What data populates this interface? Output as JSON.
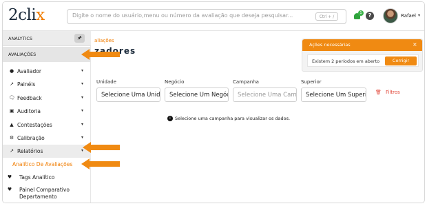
{
  "header": {
    "logo_main": "2cli",
    "logo_x": "x",
    "search_placeholder": "Digite o nome do usuário,menu ou número da avaliação que deseja pesquisar...",
    "search_shortcut": "Ctrl + /",
    "notification_count": "1",
    "help_label": "?",
    "user_name": "Rafael",
    "user_caret": "▾"
  },
  "sidebar": {
    "analytics_label": "ANALYTICS",
    "pin_icon": "🖈",
    "avaliacoes_label": "AVALIAÇÕES",
    "items": [
      {
        "icon": "●",
        "label": "Avaliador",
        "caret": "▾"
      },
      {
        "icon": "↗",
        "label": "Painéis",
        "caret": "▾"
      },
      {
        "icon": "🗨",
        "label": "Feedback",
        "caret": "▾"
      },
      {
        "icon": "▣",
        "label": "Auditoria",
        "caret": "▾"
      },
      {
        "icon": "▲",
        "label": "Contestações",
        "caret": "▾"
      },
      {
        "icon": "⚙",
        "label": "Calibração",
        "caret": "▾"
      },
      {
        "icon": "↗",
        "label": "Relatórios",
        "caret": "▾"
      }
    ],
    "sub_items": [
      {
        "icon": "",
        "label": "Analítico De Avaliações"
      },
      {
        "icon": "♥",
        "label": "Tags Analítico"
      },
      {
        "icon": "♥",
        "label": "Painel Comparativo"
      },
      {
        "icon": "",
        "label": "Departamento"
      }
    ]
  },
  "main": {
    "breadcrumb": "aliações",
    "title": "zadores",
    "filters": [
      {
        "label": "Unidade",
        "value": "Selecione Uma Unida"
      },
      {
        "label": "Negócio",
        "value": "Selecione Um Negóc"
      },
      {
        "label": "Campanha",
        "value": "Selecione Uma Camp"
      },
      {
        "label": "Superior",
        "value": "Selecione Um Superi"
      }
    ],
    "filtros_label": "Filtros",
    "filtros_icon": "🗑",
    "info_text": "Selecione uma campanha para visualizar os dados."
  },
  "actions_panel": {
    "title": "Ações necessárias",
    "close": "×",
    "message": "Existem 2 períodos em aberto",
    "button": "Corrigir"
  },
  "colors": {
    "accent": "#f08a12",
    "danger": "#e2493b",
    "success": "#2fa33c"
  }
}
